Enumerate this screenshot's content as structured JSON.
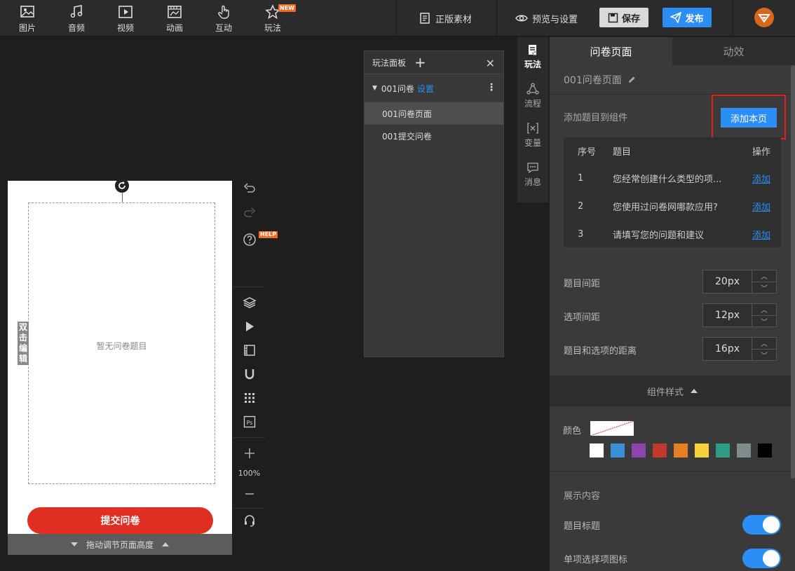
{
  "toolbar": {
    "tools": [
      {
        "label": "图片",
        "icon": "image-icon"
      },
      {
        "label": "音频",
        "icon": "music-icon"
      },
      {
        "label": "视频",
        "icon": "video-icon"
      },
      {
        "label": "动画",
        "icon": "animation-icon"
      },
      {
        "label": "互动",
        "icon": "hand-icon"
      },
      {
        "label": "玩法",
        "icon": "star-icon",
        "badge": "NEW"
      }
    ],
    "genuine_assets": "正版素材",
    "preview_settings": "预览与设置",
    "save": "保存",
    "publish": "发布"
  },
  "canvas": {
    "empty_text": "暂无问卷题目",
    "double_click_edit": "双击编辑",
    "submit_button": "提交问卷",
    "drag_adjust": "拖动调节页面高度",
    "help_badge": "HELP",
    "zoom": "100%"
  },
  "play_panel": {
    "title": "玩法面板",
    "group_name": "001问卷",
    "group_setting": "设置",
    "items": [
      {
        "label": "001问卷页面",
        "active": true
      },
      {
        "label": "001提交问卷",
        "active": false
      }
    ]
  },
  "vertical_tabs": [
    {
      "label": "玩法",
      "active": true
    },
    {
      "label": "流程",
      "active": false
    },
    {
      "label": "变量",
      "active": false
    },
    {
      "label": "消息",
      "active": false
    }
  ],
  "right_panel": {
    "tabs": [
      {
        "label": "问卷页面",
        "active": true
      },
      {
        "label": "动效",
        "active": false
      }
    ],
    "page_name": "001问卷页面",
    "add_to_component": "添加题目到组件",
    "add_page_button": "添加本页",
    "table": {
      "headers": [
        "序号",
        "题目",
        "操作"
      ],
      "rows": [
        {
          "num": "1",
          "title": "您经常创建什么类型的项...",
          "op": "添加"
        },
        {
          "num": "2",
          "title": "您使用过问卷网哪款应用?",
          "op": "添加"
        },
        {
          "num": "3",
          "title": "请填写您的问题和建议",
          "op": "添加"
        }
      ]
    },
    "spacing": [
      {
        "label": "题目间距",
        "value": "20px"
      },
      {
        "label": "选项间距",
        "value": "12px"
      },
      {
        "label": "题目和选项的距离",
        "value": "16px"
      }
    ],
    "style_section": "组件样式",
    "color_label": "颜色",
    "swatches": [
      "#ffffff",
      "#3b8fd9",
      "#8e44ad",
      "#c0392b",
      "#e67e22",
      "#f6d23c",
      "#2e9c84",
      "#7f8c8d",
      "#000000"
    ],
    "display_content": "展示内容",
    "toggles": [
      {
        "label": "题目标题",
        "on": true
      },
      {
        "label": "单项选择项图标",
        "on": true
      }
    ]
  },
  "colors": {
    "accent": "#2b8ef4",
    "submit": "#e02f22",
    "highlight": "#e0231a",
    "badge": "#f26b22"
  }
}
